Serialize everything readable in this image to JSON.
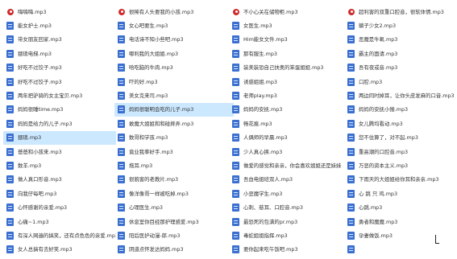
{
  "files": {
    "column1": [
      {
        "name": "嗨嗨嗨.mp3",
        "icon": "disc-icon"
      },
      {
        "name": "能女护士.mp3",
        "icon": "mp3-file-icon"
      },
      {
        "name": "带女朋友回家.mp3",
        "icon": "mp3-file-icon"
      },
      {
        "name": "猥琐电梯.mp3",
        "icon": "mp3-file-icon"
      },
      {
        "name": "好吃不过饺子.mp3",
        "icon": "mp3-file-icon"
      },
      {
        "name": "好吃不过饺子.mp3",
        "icon": "mp3-file-icon"
      },
      {
        "name": "两年把驴骑的女主宝贝.mp3",
        "icon": "mp3-file-icon"
      },
      {
        "name": "妈妈很睡time.mp3",
        "icon": "mp3-file-icon"
      },
      {
        "name": "妈妈是给力的儿子.mp3",
        "icon": "mp3-file-icon"
      },
      {
        "name": "猥琐.mp3",
        "icon": "mp3-file-icon",
        "selected": true
      },
      {
        "name": "爸爸和小孩来.mp3",
        "icon": "mp3-file-icon"
      },
      {
        "name": "数羊.mp3",
        "icon": "mp3-file-icon"
      },
      {
        "name": "做人真口形音.mp3",
        "icon": "mp3-file-icon"
      },
      {
        "name": "向我仔每吧.mp3",
        "icon": "mp3-file-icon"
      },
      {
        "name": "心怀感谢的亲爱.mp3",
        "icon": "mp3-file-icon"
      },
      {
        "name": "心痛~1.mp3",
        "icon": "mp3-file-icon"
      },
      {
        "name": "有深人网遍的搞笑，还有点色色的亲爱.mp3",
        "icon": "mp3-file-icon"
      },
      {
        "name": "女人总搞有去好笑.mp3",
        "icon": "mp3-file-icon"
      }
    ],
    "column2": [
      {
        "name": "很稀有人头要我的小孩.mp3",
        "icon": "disc-icon"
      },
      {
        "name": "女心吧要生.mp3",
        "icon": "mp3-file-icon"
      },
      {
        "name": "电话诗不知小些吧.mp3",
        "icon": "mp3-file-icon"
      },
      {
        "name": "哪利我的大姐姐.mp3",
        "icon": "mp3-file-icon"
      },
      {
        "name": "哈吃脑的牛肉.mp3",
        "icon": "mp3-file-icon"
      },
      {
        "name": "吓的好.mp3",
        "icon": "mp3-file-icon"
      },
      {
        "name": "美女克来司.mp3",
        "icon": "mp3-file-icon"
      },
      {
        "name": "妈妈很聪明会吃的儿子.mp3",
        "icon": "mp3-file-icon",
        "selected": true
      },
      {
        "name": "敢魔大姐姐和和碰摔弄.mp3",
        "icon": "mp3-file-icon"
      },
      {
        "name": "数哥和学孩.mp3",
        "icon": "mp3-file-icon"
      },
      {
        "name": "竟业我拳好手.mp3",
        "icon": "mp3-file-icon"
      },
      {
        "name": "拖耳.mp3",
        "icon": "mp3-file-icon"
      },
      {
        "name": "很貌害的老教片.mp3",
        "icon": "mp3-file-icon"
      },
      {
        "name": "像洋像哥一样被吃掉.mp3",
        "icon": "mp3-file-icon"
      },
      {
        "name": "心理医生.mp3",
        "icon": "mp3-file-icon"
      },
      {
        "name": "休息室你目经那护理感爱.mp3",
        "icon": "mp3-file-icon"
      },
      {
        "name": "阳后医护动漫-郎.mp3",
        "icon": "mp3-file-icon"
      },
      {
        "name": "阴道点怀发达妈妈.mp3",
        "icon": "mp3-file-icon"
      }
    ],
    "column3": [
      {
        "name": "不小心关在储物柜.mp3",
        "icon": "disc-icon"
      },
      {
        "name": "女医生.mp3",
        "icon": "mp3-file-icon"
      },
      {
        "name": "Him能女文件.mp3",
        "icon": "mp3-file-icon"
      },
      {
        "name": "那有服生.mp3",
        "icon": "mp3-file-icon"
      },
      {
        "name": "装美装恐自己扶奥的笨蛋姐姐.mp3",
        "icon": "mp3-file-icon"
      },
      {
        "name": "诱惑姐姐.mp3",
        "icon": "mp3-file-icon"
      },
      {
        "name": "老师play.mp3",
        "icon": "mp3-file-icon"
      },
      {
        "name": "妈妈的安抚.mp3",
        "icon": "mp3-file-icon"
      },
      {
        "name": "畅花痕.mp3",
        "icon": "mp3-file-icon"
      },
      {
        "name": "人偶师的早晨.mp3",
        "icon": "mp3-file-icon"
      },
      {
        "name": "少人真心换.mp3",
        "icon": "mp3-file-icon"
      },
      {
        "name": "做爱的感觉和亲亲，你会喜欢姐姐还是妹妹.mp3",
        "icon": "mp3-file-icon"
      },
      {
        "name": "吾血电姐班双人.mp3",
        "icon": "mp3-file-icon"
      },
      {
        "name": "小恶魔学生.mp3",
        "icon": "mp3-file-icon"
      },
      {
        "name": "心刺、慈耳、口腔音.mp3",
        "icon": "mp3-file-icon"
      },
      {
        "name": "最恐死的包满的pr.mp3",
        "icon": "mp3-file-icon"
      },
      {
        "name": "毒蛇姐姐指挥.mp3",
        "icon": "mp3-file-icon"
      },
      {
        "name": "要你起来吃午饭吧.mp3",
        "icon": "mp3-file-icon"
      }
    ],
    "column4": [
      {
        "name": "超利害的双重口腔音，很软体情.mp3",
        "icon": "disc-icon"
      },
      {
        "name": "躺子少女2.mp3",
        "icon": "mp3-file-icon"
      },
      {
        "name": "恶魔是牛氧.mp3",
        "icon": "mp3-file-icon"
      },
      {
        "name": "霸主的面请.mp3",
        "icon": "mp3-file-icon"
      },
      {
        "name": "吾有夜或音.mp3",
        "icon": "mp3-file-icon"
      },
      {
        "name": "口腔.mp3",
        "icon": "mp3-file-icon"
      },
      {
        "name": "两边同时掉耳，让你头皮发麻的口音.mp3",
        "icon": "mp3-file-icon"
      },
      {
        "name": "妈妈的安抚小猴.mp3",
        "icon": "mp3-file-icon"
      },
      {
        "name": "女儿腾均看动.mp3",
        "icon": "mp3-file-icon"
      },
      {
        "name": "您不住算了，对不起.mp3",
        "icon": "mp3-file-icon"
      },
      {
        "name": "重高潮的口腔音.mp3",
        "icon": "mp3-file-icon"
      },
      {
        "name": "万恶的资本主义.mp3",
        "icon": "mp3-file-icon"
      },
      {
        "name": "下雨天的大姐姐给你耳和亲亲.mp3",
        "icon": "mp3-file-icon"
      },
      {
        "name": "心 跳 只 鸡.mp3",
        "icon": "mp3-file-icon"
      },
      {
        "name": "心跳.mp3",
        "icon": "mp3-file-icon"
      },
      {
        "name": "勇者和魔魔.mp3",
        "icon": "mp3-file-icon"
      },
      {
        "name": "孕妻做饭.mp3",
        "icon": "mp3-file-icon"
      },
      {
        "name": "",
        "icon": "mp3-file-icon"
      }
    ]
  }
}
